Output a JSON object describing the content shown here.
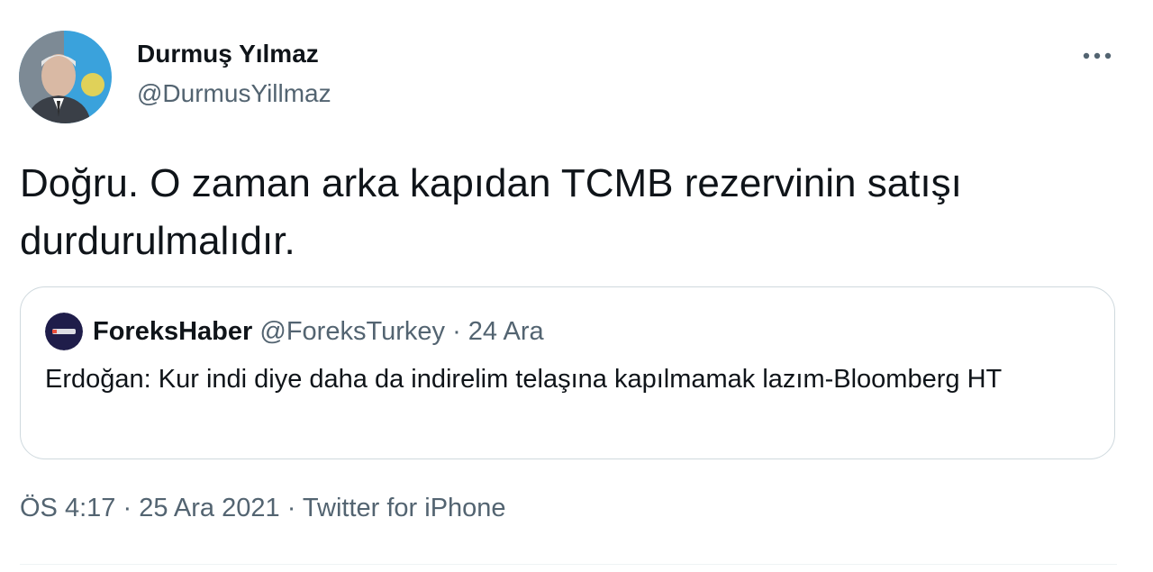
{
  "author": {
    "name": "Durmuş Yılmaz",
    "handle": "@DurmusYillmaz"
  },
  "tweet": {
    "text": "Doğru. O zaman arka kapıdan TCMB rezervinin satışı durdurulmalıdır."
  },
  "quoted_tweet": {
    "name": "ForeksHaber",
    "handle": "@ForeksTurkey",
    "separator": "·",
    "date": "24 Ara",
    "text": "Erdoğan: Kur indi diye daha da indirelim telaşına kapılmamak lazım-Bloomberg HT"
  },
  "meta": {
    "time": "ÖS 4:17",
    "date": "25 Ara 2021",
    "separator": "·",
    "source": "Twitter for iPhone"
  },
  "icons": {
    "more": "more-horizontal-icon",
    "avatar": "profile-photo",
    "quote_avatar": "foreks-logo"
  },
  "colors": {
    "text_primary": "#0f1419",
    "text_secondary": "#536471",
    "border": "#cfd9de",
    "avatar_bg": "#3aa2dc",
    "quote_avatar_bg": "#1f1d4a"
  }
}
